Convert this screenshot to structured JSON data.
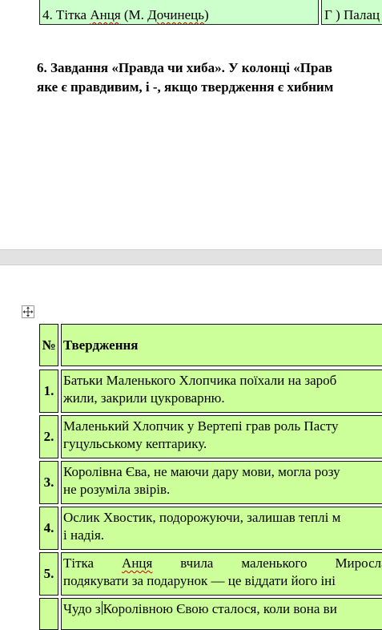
{
  "prev_table": {
    "cell_left": "4. Тітка Анця (М. Дочинець)",
    "cell_left_parts": [
      "4. Тітка ",
      "Анця",
      " (М. ",
      "Дочинець",
      ")"
    ],
    "cell_right": "Г ) Палац"
  },
  "task": {
    "line1": "6. Завдання  «Правда чи хиба».  У колонці «Прав",
    "line2": "яке є правдивим, і -, якщо твердження є хибним"
  },
  "table": {
    "header": {
      "num": "№",
      "text": "Твердження"
    },
    "rows": [
      {
        "num": "1.",
        "line1": "Батьки Маленького Хлопчика поїхали на зароб",
        "line2": "жили, закрили цукроварню."
      },
      {
        "num": "2.",
        "line1": "Маленький Хлопчик у Вертепі грав роль Пасту",
        "line2": "гуцульському кептарику."
      },
      {
        "num": "3.",
        "line1": "Королівна Єва, не маючи дару мови, могла розу",
        "line2": "не розуміла звірів."
      },
      {
        "num": "4.",
        "line1": "Ослик Хвостик, подорожуючи, залишав теплі м",
        "line2": "і надія."
      },
      {
        "num": "5.",
        "line1_words": [
          "Тітка",
          "Анця",
          "вчила",
          "маленького",
          "Мирослава"
        ],
        "line2": "подякувати за подарунок — це віддати його іні"
      },
      {
        "num": "",
        "line1_a": "Чудо з",
        "line1_b": "Королівною Євою сталося, коли вона ви"
      }
    ]
  }
}
